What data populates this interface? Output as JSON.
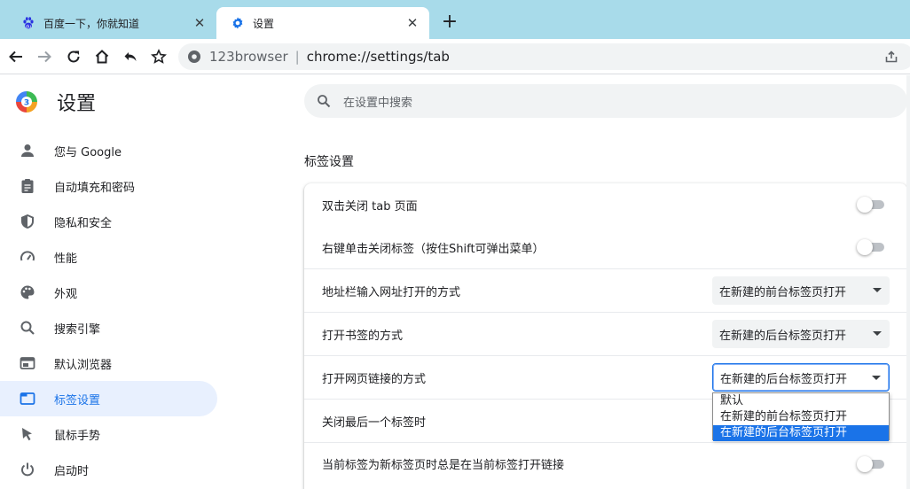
{
  "tabs": [
    {
      "title": "百度一下，你就知道",
      "icon": "baidu-paw-icon",
      "active": false
    },
    {
      "title": "设置",
      "icon": "gear-icon",
      "active": true
    }
  ],
  "new_tab_label": "+",
  "omnibox": {
    "host": "123browser",
    "separator": "|",
    "url": "chrome://settings/tab"
  },
  "sidebar": {
    "title": "设置",
    "items": [
      {
        "label": "您与 Google",
        "icon": "person-icon"
      },
      {
        "label": "自动填充和密码",
        "icon": "clipboard-icon"
      },
      {
        "label": "隐私和安全",
        "icon": "shield-icon"
      },
      {
        "label": "性能",
        "icon": "speedometer-icon"
      },
      {
        "label": "外观",
        "icon": "palette-icon"
      },
      {
        "label": "搜索引擎",
        "icon": "search-icon"
      },
      {
        "label": "默认浏览器",
        "icon": "browser-window-icon"
      },
      {
        "label": "标签设置",
        "icon": "tab-icon",
        "active": true
      },
      {
        "label": "鼠标手势",
        "icon": "cursor-icon"
      },
      {
        "label": "启动时",
        "icon": "power-icon"
      }
    ]
  },
  "search": {
    "placeholder": "在设置中搜索"
  },
  "section_title": "标签设置",
  "settings": {
    "rows": [
      {
        "label": "双击关闭 tab 页面",
        "control": "toggle",
        "on": false
      },
      {
        "label": "右键单击关闭标签（按住Shift可弹出菜单）",
        "control": "toggle",
        "on": false
      },
      {
        "label": "地址栏输入网址打开的方式",
        "control": "select",
        "value": "在新建的前台标签页打开"
      },
      {
        "label": "打开书签的方式",
        "control": "select",
        "value": "在新建的后台标签页打开"
      },
      {
        "label": "打开网页链接的方式",
        "control": "select",
        "value": "在新建的后台标签页打开",
        "open": true
      },
      {
        "label": "关闭最后一个标签时",
        "control": "select-hidden"
      },
      {
        "label": "当前标签为新标签页时总是在当前标签打开链接",
        "control": "toggle",
        "on": false
      }
    ]
  },
  "dropdown": {
    "options": [
      "默认",
      "在新建的前台标签页打开",
      "在新建的后台标签页打开"
    ],
    "selected_index": 2
  },
  "colors": {
    "tabstrip": "#a8dbea",
    "accent": "#1a73e8",
    "active_nav_bg": "#e8f0fe"
  }
}
